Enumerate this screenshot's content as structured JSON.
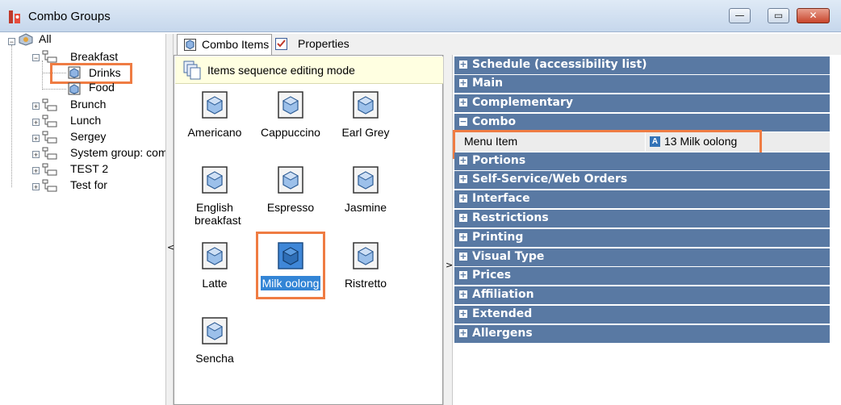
{
  "window": {
    "title": "Combo Groups",
    "min_glyph": "—",
    "max_glyph": "▭",
    "close_glyph": "✕"
  },
  "tree": {
    "root": "All",
    "nodes": [
      {
        "label": "Breakfast",
        "expanded": true,
        "children": [
          "Drinks",
          "Food"
        ]
      },
      {
        "label": "Brunch"
      },
      {
        "label": "Lunch"
      },
      {
        "label": "Sergey"
      },
      {
        "label": "System group: comb"
      },
      {
        "label": "TEST 2"
      },
      {
        "label": "Test for"
      }
    ],
    "expanded_sign": "−",
    "collapsed_sign": "+"
  },
  "tabs": [
    {
      "label": "Combo Items",
      "active": true
    },
    {
      "label": "Properties",
      "active": false
    }
  ],
  "items_panel": {
    "mode_text": "Items sequence editing mode",
    "items": [
      "Americano",
      "Cappuccino",
      "Earl Grey",
      "English breakfast",
      "Espresso",
      "Jasmine",
      "Latte",
      "Milk oolong",
      "Ristretto",
      "Sencha"
    ],
    "selected": "Milk oolong"
  },
  "splitters": {
    "left_arrow": "<",
    "mid_arrow": ">"
  },
  "properties": {
    "sections_before": [
      {
        "label": "Schedule (accessibility list)",
        "sign": "+"
      },
      {
        "label": "Main",
        "sign": "+"
      },
      {
        "label": "Complementary",
        "sign": "+"
      },
      {
        "label": "Combo",
        "sign": "−"
      }
    ],
    "menu_item": {
      "label": "Menu Item",
      "value_icon": "A",
      "value": "13 Milk oolong"
    },
    "sections_after": [
      {
        "label": "Portions",
        "sign": "+"
      },
      {
        "label": "Self-Service/Web Orders",
        "sign": "+"
      },
      {
        "label": "Interface",
        "sign": "+"
      },
      {
        "label": "Restrictions",
        "sign": "+"
      },
      {
        "label": "Printing",
        "sign": "+"
      },
      {
        "label": "Visual Type",
        "sign": "+"
      },
      {
        "label": "Prices",
        "sign": "+"
      },
      {
        "label": "Affiliation",
        "sign": "+"
      },
      {
        "label": "Extended",
        "sign": "+"
      },
      {
        "label": "Allergens",
        "sign": "+"
      }
    ]
  },
  "colors": {
    "section_bg": "#5979a3",
    "highlight": "#ef7c43",
    "selection": "#3385d6"
  }
}
